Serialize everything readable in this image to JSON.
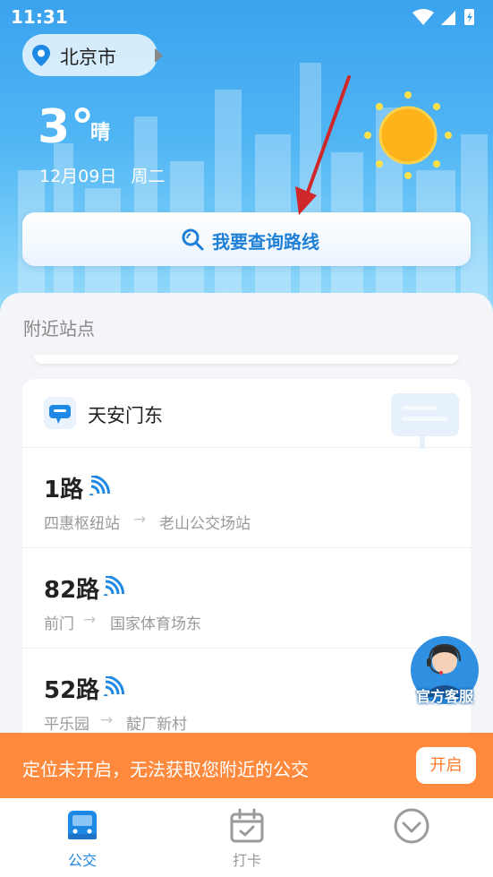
{
  "status_bar": {
    "time": "11:31"
  },
  "location": {
    "city": "北京市"
  },
  "weather": {
    "temperature": "3°",
    "condition": "晴",
    "date": "12月09日",
    "weekday": "周二"
  },
  "search": {
    "label": "我要查询路线"
  },
  "nearby": {
    "title": "附近站点",
    "stop": {
      "name": "天安门东",
      "routes": [
        {
          "name": "1路",
          "from": "四惠枢纽站",
          "to": "老山公交场站"
        },
        {
          "name": "82路",
          "from": "前门",
          "to": "国家体育场东"
        },
        {
          "name": "52路",
          "from": "平乐园",
          "to": "靛厂新村"
        }
      ]
    }
  },
  "customer_service": {
    "label": "官方客服"
  },
  "banner": {
    "message": "定位未开启，无法获取您附近的公交",
    "button": "开启"
  },
  "tabs": [
    {
      "label": "公交",
      "icon": "bus-icon",
      "active": true
    },
    {
      "label": "打卡",
      "icon": "calendar-check-icon",
      "active": false
    },
    {
      "label": "",
      "icon": "chevron-circle-icon",
      "active": false
    }
  ],
  "colors": {
    "accent": "#1e88e5",
    "banner": "#ff8a3d",
    "sun": "#ffb31a",
    "annotation_arrow": "#d0282a"
  }
}
